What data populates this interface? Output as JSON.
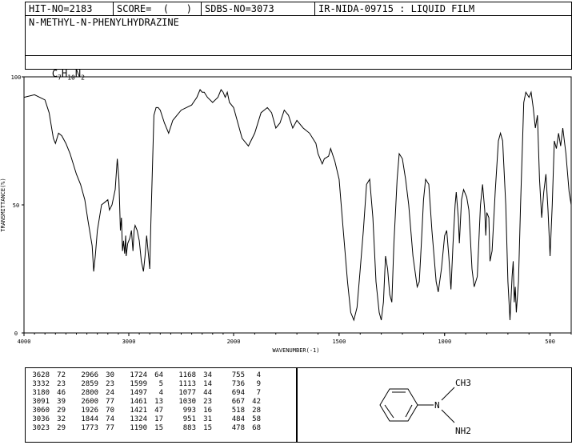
{
  "header": {
    "hit_no": "HIT-NO=2183",
    "score": "SCORE=  (   )",
    "sdbs_no": "SDBS-NO=3073",
    "method": "IR-NIDA-09715 : LIQUID FILM",
    "compound_name": "N-METHYL-N-PHENYLHYDRAZINE",
    "formula": {
      "c": "C",
      "c_n": "7",
      "h": "H",
      "h_n": "10",
      "n": "N",
      "n_n": "2"
    }
  },
  "chart_data": {
    "type": "line",
    "title": "",
    "xlabel": "WAVENUMBER(-1)",
    "ylabel": "TRANSMITTANCE(%)",
    "xlim": [
      4000,
      400
    ],
    "ylim": [
      0,
      100
    ],
    "x_ticks": [
      4000,
      3000,
      2000,
      1500,
      1000,
      500
    ],
    "y_ticks": [
      0,
      50,
      100
    ],
    "grid": false,
    "series": [
      {
        "points": [
          [
            4000,
            92
          ],
          [
            3900,
            93
          ],
          [
            3800,
            91
          ],
          [
            3760,
            86
          ],
          [
            3720,
            76
          ],
          [
            3700,
            74
          ],
          [
            3670,
            78
          ],
          [
            3640,
            77
          ],
          [
            3600,
            74
          ],
          [
            3560,
            70
          ],
          [
            3500,
            62
          ],
          [
            3460,
            58
          ],
          [
            3420,
            52
          ],
          [
            3390,
            44
          ],
          [
            3350,
            34
          ],
          [
            3335,
            24
          ],
          [
            3320,
            30
          ],
          [
            3300,
            40
          ],
          [
            3260,
            50
          ],
          [
            3230,
            51
          ],
          [
            3200,
            52
          ],
          [
            3185,
            48
          ],
          [
            3160,
            50
          ],
          [
            3130,
            56
          ],
          [
            3110,
            68
          ],
          [
            3095,
            60
          ],
          [
            3080,
            40
          ],
          [
            3070,
            45
          ],
          [
            3060,
            32
          ],
          [
            3050,
            36
          ],
          [
            3040,
            31
          ],
          [
            3030,
            38
          ],
          [
            3025,
            30
          ],
          [
            3010,
            35
          ],
          [
            2990,
            37
          ],
          [
            2975,
            40
          ],
          [
            2960,
            32
          ],
          [
            2950,
            40
          ],
          [
            2940,
            42
          ],
          [
            2920,
            40
          ],
          [
            2900,
            36
          ],
          [
            2880,
            28
          ],
          [
            2860,
            24
          ],
          [
            2845,
            30
          ],
          [
            2830,
            38
          ],
          [
            2800,
            25
          ],
          [
            2790,
            42
          ],
          [
            2760,
            85
          ],
          [
            2740,
            88
          ],
          [
            2720,
            88
          ],
          [
            2700,
            87
          ],
          [
            2660,
            82
          ],
          [
            2620,
            78
          ],
          [
            2580,
            83
          ],
          [
            2500,
            87
          ],
          [
            2400,
            89
          ],
          [
            2350,
            92
          ],
          [
            2320,
            95
          ],
          [
            2300,
            94
          ],
          [
            2280,
            94
          ],
          [
            2250,
            92
          ],
          [
            2200,
            90
          ],
          [
            2150,
            92
          ],
          [
            2120,
            95
          ],
          [
            2100,
            94
          ],
          [
            2080,
            92
          ],
          [
            2060,
            94
          ],
          [
            2040,
            90
          ],
          [
            2000,
            88
          ],
          [
            1960,
            76
          ],
          [
            1930,
            73
          ],
          [
            1900,
            78
          ],
          [
            1870,
            86
          ],
          [
            1840,
            88
          ],
          [
            1820,
            86
          ],
          [
            1800,
            80
          ],
          [
            1780,
            82
          ],
          [
            1760,
            87
          ],
          [
            1740,
            85
          ],
          [
            1720,
            80
          ],
          [
            1700,
            83
          ],
          [
            1670,
            80
          ],
          [
            1640,
            78
          ],
          [
            1610,
            74
          ],
          [
            1600,
            70
          ],
          [
            1580,
            66
          ],
          [
            1570,
            68
          ],
          [
            1550,
            69
          ],
          [
            1540,
            72
          ],
          [
            1520,
            67
          ],
          [
            1500,
            60
          ],
          [
            1480,
            40
          ],
          [
            1460,
            20
          ],
          [
            1445,
            8
          ],
          [
            1430,
            5
          ],
          [
            1415,
            10
          ],
          [
            1400,
            25
          ],
          [
            1385,
            40
          ],
          [
            1370,
            58
          ],
          [
            1355,
            60
          ],
          [
            1340,
            45
          ],
          [
            1325,
            20
          ],
          [
            1310,
            8
          ],
          [
            1300,
            5
          ],
          [
            1290,
            12
          ],
          [
            1280,
            30
          ],
          [
            1270,
            25
          ],
          [
            1260,
            15
          ],
          [
            1250,
            12
          ],
          [
            1240,
            35
          ],
          [
            1225,
            60
          ],
          [
            1215,
            70
          ],
          [
            1200,
            68
          ],
          [
            1185,
            60
          ],
          [
            1170,
            50
          ],
          [
            1150,
            30
          ],
          [
            1130,
            18
          ],
          [
            1120,
            20
          ],
          [
            1110,
            35
          ],
          [
            1100,
            52
          ],
          [
            1090,
            60
          ],
          [
            1075,
            58
          ],
          [
            1060,
            40
          ],
          [
            1040,
            20
          ],
          [
            1030,
            16
          ],
          [
            1015,
            25
          ],
          [
            1000,
            38
          ],
          [
            990,
            40
          ],
          [
            980,
            30
          ],
          [
            970,
            17
          ],
          [
            960,
            35
          ],
          [
            950,
            50
          ],
          [
            945,
            55
          ],
          [
            935,
            45
          ],
          [
            930,
            35
          ],
          [
            920,
            52
          ],
          [
            910,
            56
          ],
          [
            895,
            53
          ],
          [
            885,
            48
          ],
          [
            870,
            25
          ],
          [
            860,
            18
          ],
          [
            845,
            22
          ],
          [
            830,
            50
          ],
          [
            820,
            58
          ],
          [
            810,
            48
          ],
          [
            805,
            38
          ],
          [
            800,
            47
          ],
          [
            790,
            45
          ],
          [
            785,
            28
          ],
          [
            775,
            32
          ],
          [
            760,
            55
          ],
          [
            745,
            75
          ],
          [
            735,
            78
          ],
          [
            725,
            75
          ],
          [
            710,
            50
          ],
          [
            700,
            20
          ],
          [
            690,
            5
          ],
          [
            680,
            22
          ],
          [
            675,
            28
          ],
          [
            670,
            12
          ],
          [
            665,
            18
          ],
          [
            660,
            8
          ],
          [
            650,
            20
          ],
          [
            640,
            50
          ],
          [
            625,
            90
          ],
          [
            615,
            94
          ],
          [
            600,
            92
          ],
          [
            590,
            94
          ],
          [
            580,
            88
          ],
          [
            570,
            80
          ],
          [
            560,
            85
          ],
          [
            550,
            60
          ],
          [
            540,
            45
          ],
          [
            530,
            55
          ],
          [
            520,
            62
          ],
          [
            510,
            48
          ],
          [
            500,
            30
          ],
          [
            490,
            50
          ],
          [
            480,
            75
          ],
          [
            470,
            72
          ],
          [
            460,
            78
          ],
          [
            450,
            73
          ],
          [
            440,
            80
          ],
          [
            425,
            70
          ],
          [
            410,
            55
          ],
          [
            400,
            50
          ]
        ]
      }
    ]
  },
  "peaks": [
    [
      [
        "3628",
        "72"
      ],
      [
        "2966",
        "30"
      ],
      [
        "1724",
        "64"
      ],
      [
        "1168",
        "34"
      ],
      [
        "755",
        "4"
      ]
    ],
    [
      [
        "3332",
        "23"
      ],
      [
        "2859",
        "23"
      ],
      [
        "1599",
        "5"
      ],
      [
        "1113",
        "14"
      ],
      [
        "736",
        "9"
      ]
    ],
    [
      [
        "3180",
        "46"
      ],
      [
        "2800",
        "24"
      ],
      [
        "1497",
        "4"
      ],
      [
        "1077",
        "44"
      ],
      [
        "694",
        "7"
      ]
    ],
    [
      [
        "3091",
        "39"
      ],
      [
        "2600",
        "77"
      ],
      [
        "1461",
        "13"
      ],
      [
        "1030",
        "23"
      ],
      [
        "667",
        "42"
      ]
    ],
    [
      [
        "3060",
        "29"
      ],
      [
        "1926",
        "70"
      ],
      [
        "1421",
        "47"
      ],
      [
        "993",
        "16"
      ],
      [
        "518",
        "28"
      ]
    ],
    [
      [
        "3036",
        "32"
      ],
      [
        "1844",
        "74"
      ],
      [
        "1324",
        "17"
      ],
      [
        "951",
        "31"
      ],
      [
        "484",
        "58"
      ]
    ],
    [
      [
        "3023",
        "29"
      ],
      [
        "1773",
        "77"
      ],
      [
        "1190",
        "15"
      ],
      [
        "883",
        "15"
      ],
      [
        "478",
        "68"
      ]
    ]
  ],
  "structure": {
    "methyl_label": "CH3",
    "amine_label": "NH2",
    "n_label": "N"
  }
}
